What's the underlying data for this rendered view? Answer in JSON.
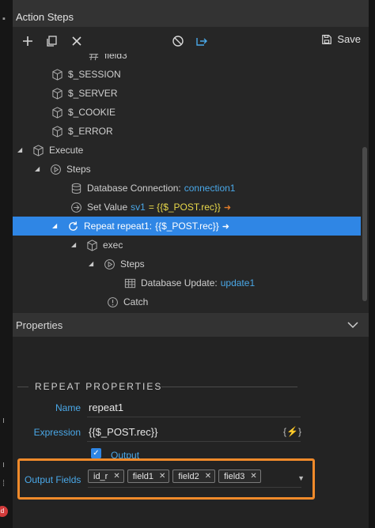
{
  "action_steps": {
    "title": "Action Steps",
    "toolbar": {
      "save_label": "Save"
    },
    "tree": [
      {
        "label": "field3",
        "icon": "hash-icon",
        "indent": 0
      },
      {
        "label": "$_SESSION",
        "icon": "cube-icon"
      },
      {
        "label": "$_SERVER",
        "icon": "cube-icon"
      },
      {
        "label": "$_COOKIE",
        "icon": "cube-icon"
      },
      {
        "label": "$_ERROR",
        "icon": "cube-icon"
      },
      {
        "label": "Execute",
        "icon": "cube-icon"
      },
      {
        "label": "Steps",
        "icon": "play-circle-icon"
      },
      {
        "label": "Database Connection:",
        "value": "connection1",
        "icon": "database-icon"
      },
      {
        "label": "Set Value",
        "value_name": "sv1",
        "value_expr": "= {{$_POST.rec}}",
        "icon": "arrow-circle-icon"
      },
      {
        "label": "Repeat repeat1:",
        "value_expr": "{{$_POST.rec}}",
        "icon": "repeat-icon"
      },
      {
        "label": "exec",
        "icon": "cube-icon"
      },
      {
        "label": "Steps",
        "icon": "play-circle-icon"
      },
      {
        "label": "Database Update:",
        "value": "update1",
        "icon": "table-icon"
      },
      {
        "label": "Catch",
        "icon": "alert-circle-icon"
      }
    ]
  },
  "properties": {
    "title": "Properties",
    "section_title": "REPEAT PROPERTIES",
    "name_label": "Name",
    "name_value": "repeat1",
    "expression_label": "Expression",
    "expression_value": "{{$_POST.rec}}",
    "output_checkbox_label": "Output",
    "output_fields_label": "Output Fields",
    "output_fields": [
      "id_r",
      "field1",
      "field2",
      "field3"
    ]
  },
  "colors": {
    "accent_blue": "#4aa8e8",
    "selection_blue": "#2f86e5",
    "highlight_orange": "#f08a2a",
    "expression_yellow": "#e8d84a"
  }
}
